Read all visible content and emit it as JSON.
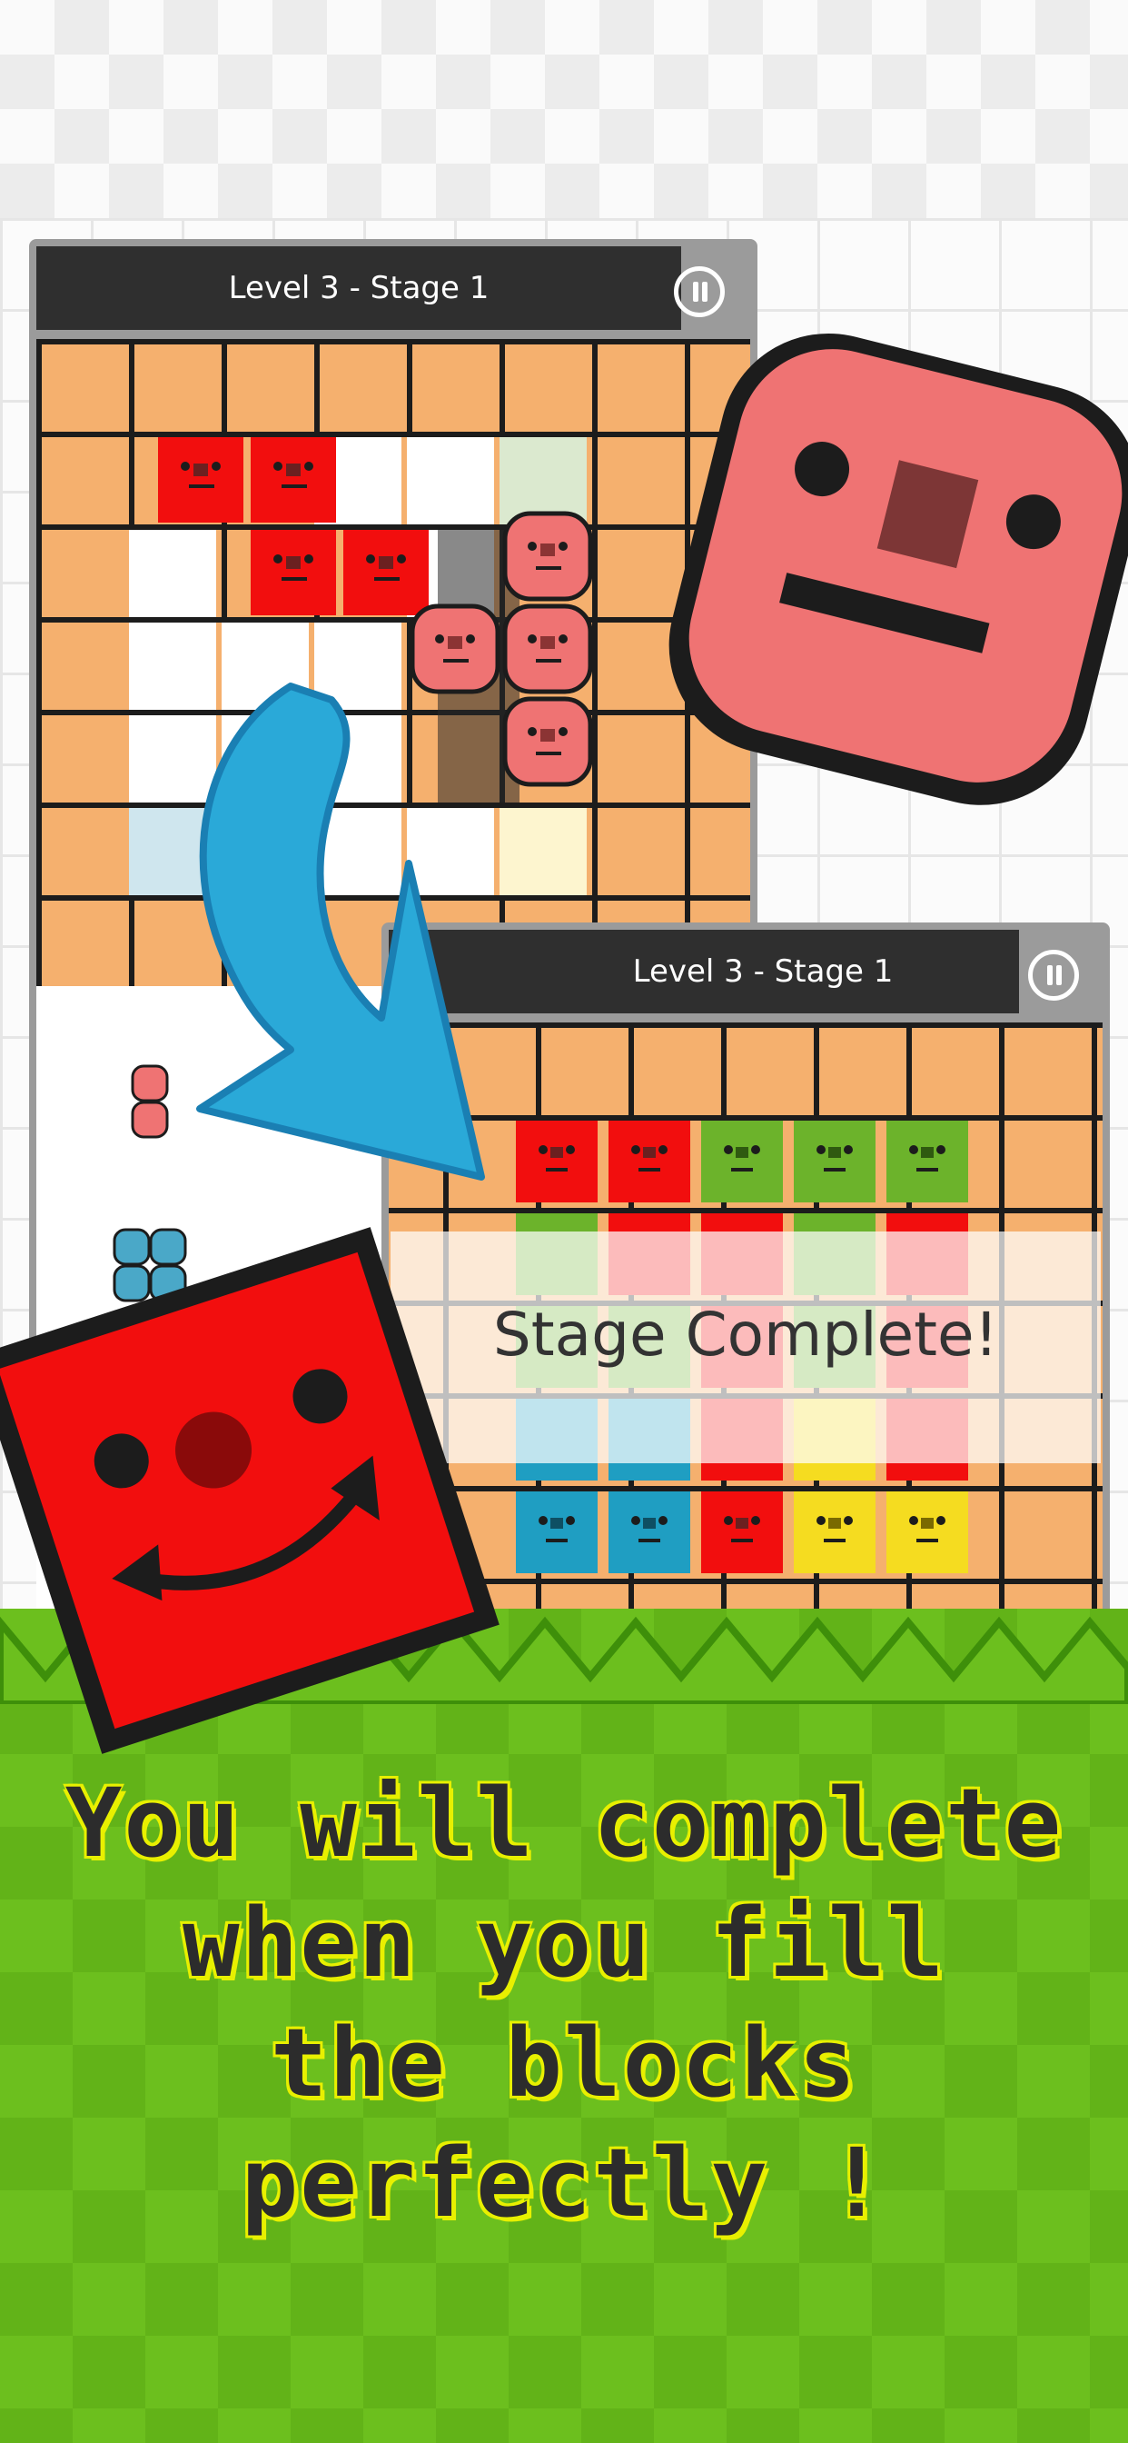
{
  "screens": {
    "top": {
      "title": "Level 3  -  Stage 1"
    },
    "bottom": {
      "title": "Level 3  -  Stage 1",
      "banner": "Stage Complete!"
    }
  },
  "headline": {
    "line1": "You will complete",
    "line2": "when you fill",
    "line3": "the blocks perfectly !"
  },
  "colors": {
    "accent_green": "#6cbf1e",
    "headline_text": "#2c2c2c",
    "headline_outline": "#e8f000",
    "arrow_blue": "#2aa9d8",
    "red_block": "#f20e0e",
    "pink_block": "#ef7373"
  }
}
